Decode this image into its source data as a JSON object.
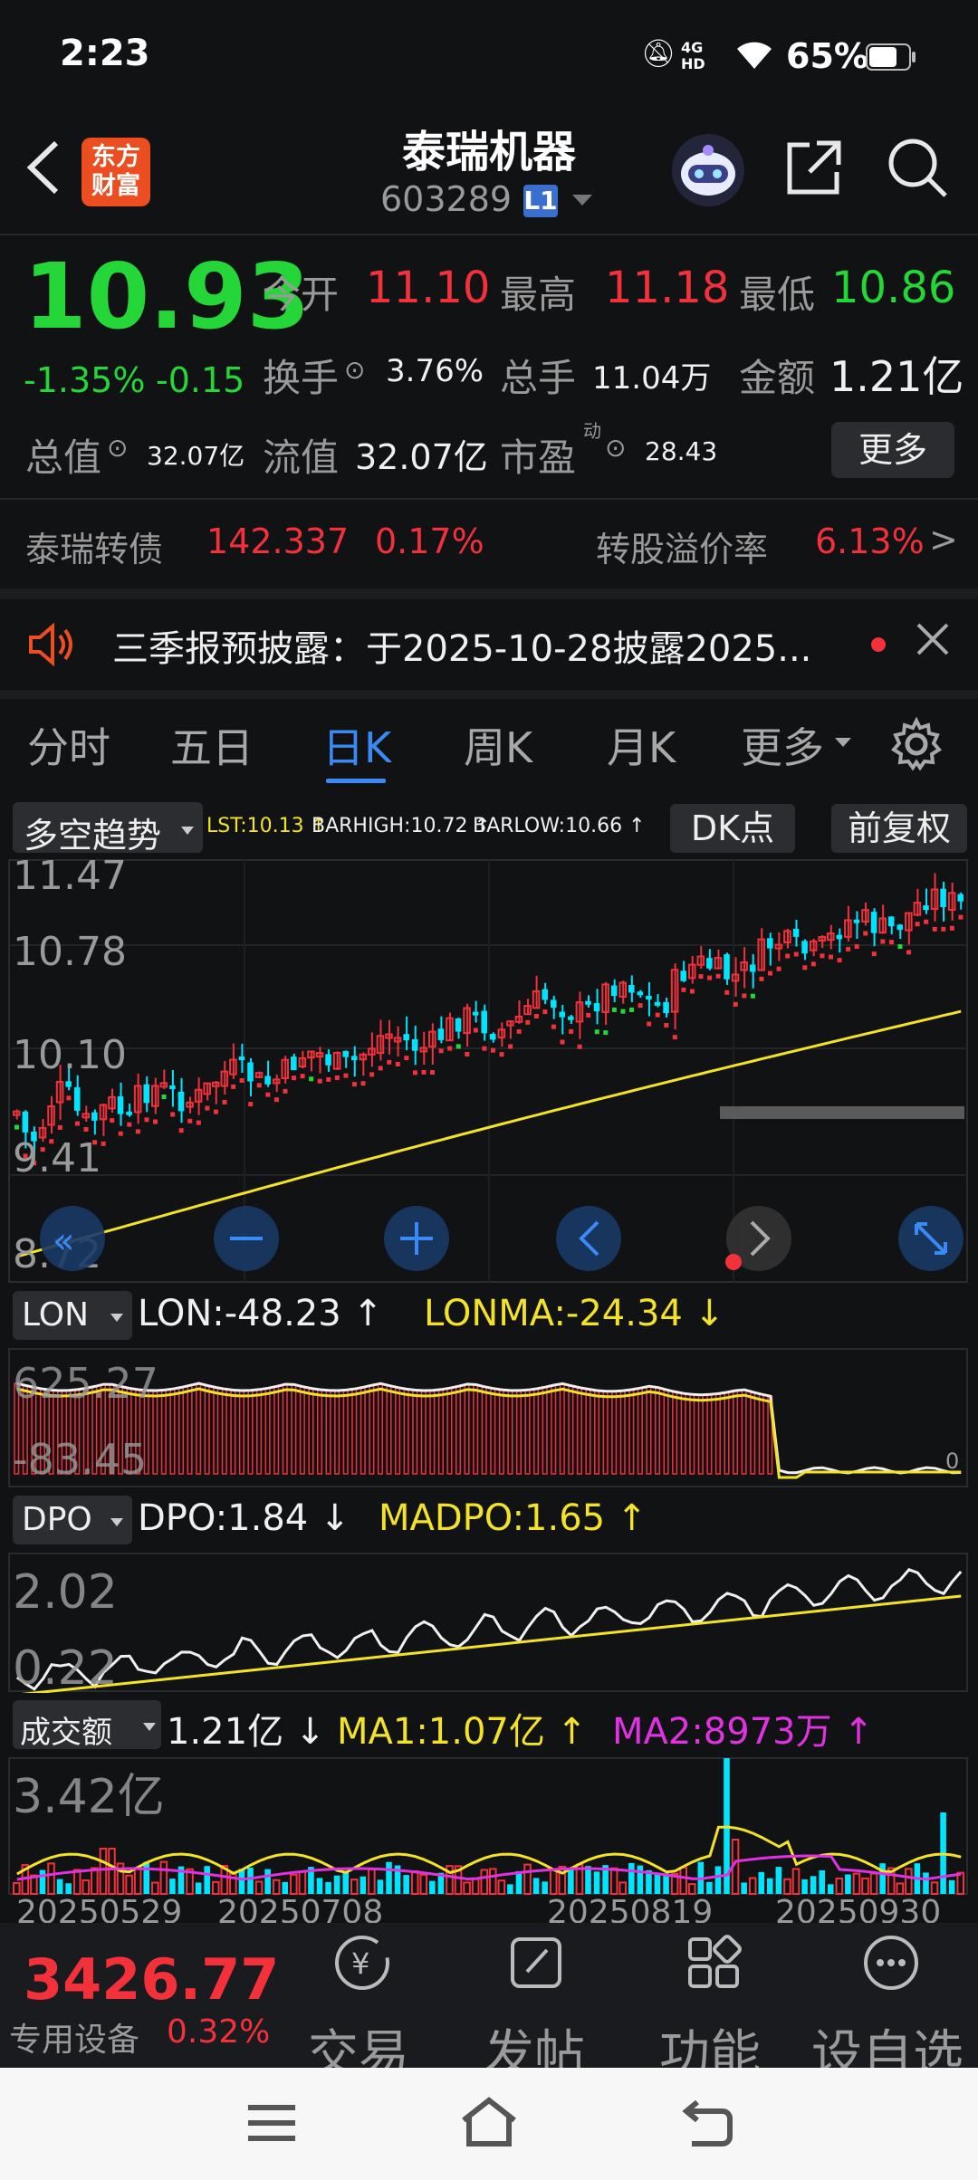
{
  "status_bar": {
    "time": "2:23",
    "network": "4G HD",
    "battery": "65%"
  },
  "header": {
    "logo_text": "东方\n财富",
    "stock_name": "泰瑞机器",
    "stock_code": "603289",
    "level_badge": "L1"
  },
  "quote": {
    "price": "10.93",
    "change_pct": "-1.35%",
    "change": "-0.15",
    "open_label": "今开",
    "open": "11.10",
    "high_label": "最高",
    "high": "11.18",
    "low_label": "最低",
    "low": "10.86",
    "turnover_label": "换手",
    "turnover": "3.76%",
    "volume_label": "总手",
    "volume": "11.04万",
    "amount_label": "金额",
    "amount": "1.21亿",
    "mktcap_label": "总值",
    "mktcap": "32.07亿",
    "float_label": "流值",
    "float": "32.07亿",
    "pe_label": "市盈",
    "pe_sup": "动",
    "pe": "28.43",
    "more_label": "更多"
  },
  "convertible": {
    "name": "泰瑞转债",
    "price": "142.337",
    "pct": "0.17%",
    "premium_label": "转股溢价率",
    "premium": "6.13%"
  },
  "notice": {
    "text": "三季报预披露：于2025-10-28披露2025..."
  },
  "tabs": [
    "分时",
    "五日",
    "日K",
    "周K",
    "月K",
    "更多"
  ],
  "active_tab": "日K",
  "kchart": {
    "indicator": "多空趋势",
    "lst": "LST:10.13 ↑",
    "barhigh": "BARHIGH:10.72 ↑",
    "barlow": "BARLOW:10.66 ↑",
    "dk_label": "DK点",
    "adjust_label": "前复权",
    "y_labels": [
      "11.47",
      "10.78",
      "10.10",
      "9.41",
      "8.72"
    ]
  },
  "lon": {
    "name": "LON",
    "value": "LON:-48.23 ↑",
    "ma": "LONMA:-24.34 ↓",
    "top": "625.27",
    "bottom": "-83.45",
    "zero": "0"
  },
  "dpo": {
    "name": "DPO",
    "value": "DPO:1.84 ↓",
    "ma": "MADPO:1.65 ↑",
    "top": "2.02",
    "bottom": "0.22"
  },
  "amount_chart": {
    "name": "成交额",
    "value": "1.21亿 ↓",
    "ma1": "MA1:1.07亿 ↑",
    "ma2": "MA2:8973万 ↑",
    "top": "3.42亿"
  },
  "dates": [
    "20250529",
    "20250708",
    "20250819",
    "20250930"
  ],
  "bottom_nav": {
    "index_value": "3426.77",
    "sector": "专用设备",
    "sector_pct": "0.32%",
    "items": [
      "交易",
      "发帖",
      "功能",
      "设自选"
    ]
  },
  "colors": {
    "up": "#f2313a",
    "down": "#24d637",
    "accent": "#3a8af5",
    "yellow": "#f3e228",
    "cyan": "#00e5ff"
  }
}
